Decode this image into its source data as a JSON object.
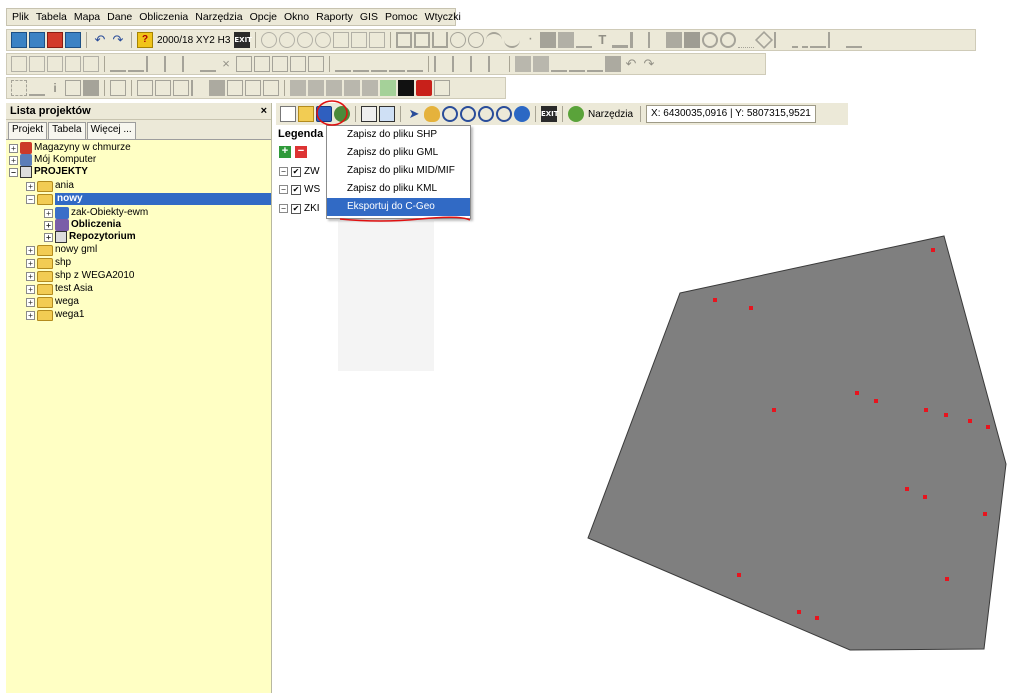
{
  "menubar": {
    "items": [
      "Plik",
      "Tabela",
      "Mapa",
      "Dane",
      "Obliczenia",
      "Narzędzia",
      "Opcje",
      "Okno",
      "Raporty",
      "GIS",
      "Pomoc",
      "Wtyczki"
    ]
  },
  "toolbar": {
    "scale_text": "2000/18 XY2 H3",
    "exit_label": "EXIT",
    "narzedzia_label": "Narzędzia",
    "coords_text": "X: 6430035,0916 | Y: 5807315,9521"
  },
  "project_panel": {
    "title": "Lista projektów",
    "close": "×",
    "tabs": [
      "Projekt",
      "Tabela",
      "Więcej ..."
    ],
    "tree": [
      {
        "label": "Magazyny w chmurze"
      },
      {
        "label": "Mój Komputer"
      },
      {
        "label": "PROJEKTY"
      },
      {
        "label": "ania"
      },
      {
        "label": "nowy"
      },
      {
        "label": "zak-Obiekty-ewm"
      },
      {
        "label": "Obliczenia"
      },
      {
        "label": "Repozytorium"
      },
      {
        "label": "nowy gml"
      },
      {
        "label": "shp"
      },
      {
        "label": "shp z WEGA2010"
      },
      {
        "label": "test Asia"
      },
      {
        "label": "wega"
      },
      {
        "label": "wega1"
      }
    ]
  },
  "legend": {
    "title": "Legenda",
    "layers": [
      {
        "label": "ZW",
        "checked": true
      },
      {
        "label": "WS",
        "checked": true
      },
      {
        "label": "ZKI",
        "checked": true
      }
    ]
  },
  "save_menu": {
    "items": [
      {
        "label": "Zapisz do pliku SHP"
      },
      {
        "label": "Zapisz do pliku GML"
      },
      {
        "label": "Zapisz do pliku MID/MIF"
      },
      {
        "label": "Zapisz do pliku KML"
      },
      {
        "label": "Eksportuj do C-Geo",
        "highlighted": true
      }
    ]
  },
  "colors": {
    "polygon_fill": "#7f7f7f",
    "point": "#e8141e",
    "selection": "#316ac5",
    "panel_bg": "#ffffc4",
    "annotation": "#e01010"
  }
}
